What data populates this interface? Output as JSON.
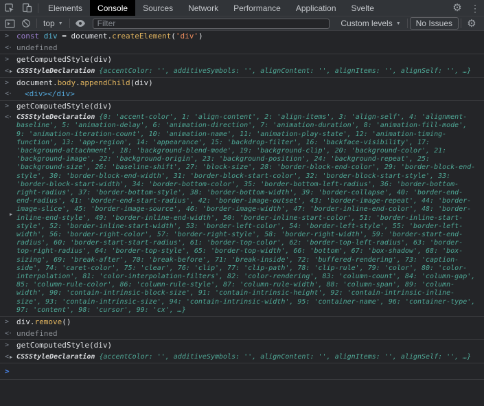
{
  "devtools": {
    "tabs": {
      "items": [
        "Elements",
        "Console",
        "Sources",
        "Network",
        "Performance",
        "Application",
        "Svelte"
      ],
      "active": "Console"
    },
    "toolbar": {
      "context_selector": "top",
      "filter_placeholder": "Filter",
      "levels_label": "Custom levels",
      "issues_label": "No Issues"
    },
    "palette": {
      "bar_bg": "#313438",
      "console_bg": "#242528",
      "active_tab_bg": "#000000",
      "keyword_purple": "#9a7ecc",
      "variable_cyan": "#58b7d6",
      "property_gold": "#e2b55f",
      "string_orange": "#ef8e5e",
      "node_blue": "#53a6d8",
      "preview_teal": "#4fa896",
      "muted_grey": "#8b8f94",
      "prompt_blue": "#4a87f0"
    },
    "console": {
      "prompt_char": ">",
      "return_arrow": "<·",
      "entries": [
        {
          "kind": "input",
          "group_start": false,
          "tokens": [
            [
              "const ",
              "kw"
            ],
            [
              "div",
              "var"
            ],
            [
              " = ",
              "plain"
            ],
            [
              "document.",
              "plain"
            ],
            [
              "createElement",
              "fn"
            ],
            [
              "(",
              "plain"
            ],
            [
              "'div'",
              "str"
            ],
            [
              ")",
              "plain"
            ]
          ]
        },
        {
          "kind": "undefined",
          "text": "undefined"
        },
        {
          "kind": "input",
          "group_start": true,
          "tokens": [
            [
              "getComputedStyle(div)",
              "plain"
            ]
          ]
        },
        {
          "kind": "preview",
          "multiline": false,
          "name": "CSSStyleDeclaration ",
          "body": "{accentColor: '', additiveSymbols: '', alignContent: '', alignItems: '', alignSelf: '', …}"
        },
        {
          "kind": "input",
          "group_start": true,
          "tokens": [
            [
              "document.",
              "plain"
            ],
            [
              "body",
              "fn"
            ],
            [
              ".",
              "plain"
            ],
            [
              "appendChild",
              "fn"
            ],
            [
              "(div)",
              "plain"
            ]
          ]
        },
        {
          "kind": "node",
          "text": "<div></div>"
        },
        {
          "kind": "input",
          "group_start": true,
          "tokens": [
            [
              "getComputedStyle(div)",
              "plain"
            ]
          ]
        },
        {
          "kind": "preview",
          "multiline": true,
          "name": "CSSStyleDeclaration ",
          "body": "{0: 'accent-color', 1: 'align-content', 2: 'align-items', 3: 'align-self', 4: 'alignment-baseline', 5: 'animation-delay', 6: 'animation-direction', 7: 'animation-duration', 8: 'animation-fill-mode', 9: 'animation-iteration-count', 10: 'animation-name', 11: 'animation-play-state', 12: 'animation-timing-function', 13: 'app-region', 14: 'appearance', 15: 'backdrop-filter', 16: 'backface-visibility', 17: 'background-attachment', 18: 'background-blend-mode', 19: 'background-clip', 20: 'background-color', 21: 'background-image', 22: 'background-origin', 23: 'background-position', 24: 'background-repeat', 25: 'background-size', 26: 'baseline-shift', 27: 'block-size', 28: 'border-block-end-color', 29: 'border-block-end-style', 30: 'border-block-end-width', 31: 'border-block-start-color', 32: 'border-block-start-style', 33: 'border-block-start-width', 34: 'border-bottom-color', 35: 'border-bottom-left-radius', 36: 'border-bottom-right-radius', 37: 'border-bottom-style', 38: 'border-bottom-width', 39: 'border-collapse', 40: 'border-end-end-radius', 41: 'border-end-start-radius', 42: 'border-image-outset', 43: 'border-image-repeat', 44: 'border-image-slice', 45: 'border-image-source', 46: 'border-image-width', 47: 'border-inline-end-color', 48: 'border-inline-end-style', 49: 'border-inline-end-width', 50: 'border-inline-start-color', 51: 'border-inline-start-style', 52: 'border-inline-start-width', 53: 'border-left-color', 54: 'border-left-style', 55: 'border-left-width', 56: 'border-right-color', 57: 'border-right-style', 58: 'border-right-width', 59: 'border-start-end-radius', 60: 'border-start-start-radius', 61: 'border-top-color', 62: 'border-top-left-radius', 63: 'border-top-right-radius', 64: 'border-top-style', 65: 'border-top-width', 66: 'bottom', 67: 'box-shadow', 68: 'box-sizing', 69: 'break-after', 70: 'break-before', 71: 'break-inside', 72: 'buffered-rendering', 73: 'caption-side', 74: 'caret-color', 75: 'clear', 76: 'clip', 77: 'clip-path', 78: 'clip-rule', 79: 'color', 80: 'color-interpolation', 81: 'color-interpolation-filters', 82: 'color-rendering', 83: 'column-count', 84: 'column-gap', 85: 'column-rule-color', 86: 'column-rule-style', 87: 'column-rule-width', 88: 'column-span', 89: 'column-width', 90: 'contain-intrinsic-block-size', 91: 'contain-intrinsic-height', 92: 'contain-intrinsic-inline-size', 93: 'contain-intrinsic-size', 94: 'contain-intrinsic-width', 95: 'container-name', 96: 'container-type', 97: 'content', 98: 'cursor', 99: 'cx', …}"
        },
        {
          "kind": "input",
          "group_start": true,
          "tokens": [
            [
              "div.",
              "plain"
            ],
            [
              "remove",
              "fn"
            ],
            [
              "()",
              "plain"
            ]
          ]
        },
        {
          "kind": "undefined",
          "text": "undefined"
        },
        {
          "kind": "input",
          "group_start": true,
          "tokens": [
            [
              "getComputedStyle(div)",
              "plain"
            ]
          ]
        },
        {
          "kind": "preview",
          "multiline": false,
          "name": "CSSStyleDeclaration ",
          "body": "{accentColor: '', additiveSymbols: '', alignContent: '', alignItems: '', alignSelf: '', …}"
        }
      ]
    }
  }
}
